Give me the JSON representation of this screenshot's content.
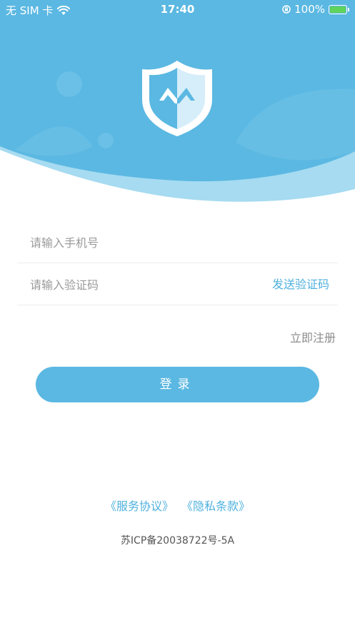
{
  "status_bar": {
    "carrier": "无 SIM 卡",
    "time": "17:40",
    "battery": "100%",
    "wifi_icon": "wifi-icon",
    "orientation_lock_icon": "orientation-lock-icon",
    "battery_icon": "battery-charging-icon"
  },
  "header": {
    "logo_icon": "shield-logo-icon",
    "bg_color": "#5bb8e2"
  },
  "form": {
    "phone_placeholder": "请输入手机号",
    "phone_value": "",
    "code_placeholder": "请输入验证码",
    "code_value": "",
    "send_code_label": "发送验证码",
    "register_label": "立即注册",
    "login_label": "登录"
  },
  "footer": {
    "service_agreement": "《服务协议》",
    "privacy_policy": "《隐私条款》",
    "icp": "苏ICP备20038722号-5A"
  },
  "colors": {
    "accent": "#4fb1de",
    "button": "#5bb8e2"
  }
}
